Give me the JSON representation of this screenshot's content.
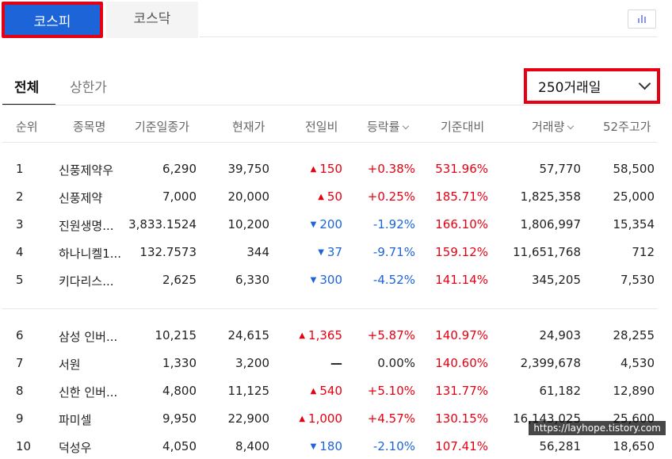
{
  "market_tabs": [
    {
      "label": "코스피"
    },
    {
      "label": "코스닥"
    }
  ],
  "filter_tabs": [
    {
      "label": "전체"
    },
    {
      "label": "상한가"
    }
  ],
  "period_select": {
    "value": "250거래일"
  },
  "icons": {
    "chart_toggle": "bar-chart-icon",
    "dropdown": "chevron-down-icon"
  },
  "colors": {
    "up": "#e60012",
    "down": "#1c64d8",
    "accent": "#1c64d8"
  },
  "table": {
    "headers": [
      "순위",
      "종목명",
      "기준일종가",
      "현재가",
      "전일비",
      "등락률",
      "기준대비",
      "거래량",
      "52주고가"
    ],
    "rows": [
      {
        "rank": "1",
        "name": "신풍제약우",
        "base": "6,290",
        "current": "39,750",
        "diff": "150",
        "dir": "up",
        "rate": "+0.38%",
        "vs": "531.96%",
        "volume": "57,770",
        "high52": "58,500"
      },
      {
        "rank": "2",
        "name": "신풍제약",
        "base": "7,000",
        "current": "20,000",
        "diff": "50",
        "dir": "up",
        "rate": "+0.25%",
        "vs": "185.71%",
        "volume": "1,825,358",
        "high52": "25,000"
      },
      {
        "rank": "3",
        "name": "진원생명...",
        "base": "3,833.1524",
        "current": "10,200",
        "diff": "200",
        "dir": "down",
        "rate": "-1.92%",
        "vs": "166.10%",
        "volume": "1,806,997",
        "high52": "15,354"
      },
      {
        "rank": "4",
        "name": "하나니켈1...",
        "base": "132.7573",
        "current": "344",
        "diff": "37",
        "dir": "down",
        "rate": "-9.71%",
        "vs": "159.12%",
        "volume": "11,651,768",
        "high52": "712"
      },
      {
        "rank": "5",
        "name": "키다리스...",
        "base": "2,625",
        "current": "6,330",
        "diff": "300",
        "dir": "down",
        "rate": "-4.52%",
        "vs": "141.14%",
        "volume": "345,205",
        "high52": "7,530"
      },
      {
        "rank": "6",
        "name": "삼성 인버...",
        "base": "10,215",
        "current": "24,615",
        "diff": "1,365",
        "dir": "up",
        "rate": "+5.87%",
        "vs": "140.97%",
        "volume": "24,903",
        "high52": "28,255"
      },
      {
        "rank": "7",
        "name": "서원",
        "base": "1,330",
        "current": "3,200",
        "diff": "",
        "dir": "flat",
        "rate": "0.00%",
        "vs": "140.60%",
        "volume": "2,399,678",
        "high52": "4,530"
      },
      {
        "rank": "8",
        "name": "신한 인버...",
        "base": "4,800",
        "current": "11,125",
        "diff": "540",
        "dir": "up",
        "rate": "+5.10%",
        "vs": "131.77%",
        "volume": "61,182",
        "high52": "12,890"
      },
      {
        "rank": "9",
        "name": "파미셀",
        "base": "9,950",
        "current": "22,900",
        "diff": "1,000",
        "dir": "up",
        "rate": "+4.57%",
        "vs": "130.15%",
        "volume": "16,143,025",
        "high52": "25,600"
      },
      {
        "rank": "10",
        "name": "덕성우",
        "base": "4,050",
        "current": "8,400",
        "diff": "180",
        "dir": "down",
        "rate": "-2.10%",
        "vs": "107.41%",
        "volume": "56,281",
        "high52": "18,650"
      }
    ]
  },
  "watermark": "https://layhope.tistory.com"
}
